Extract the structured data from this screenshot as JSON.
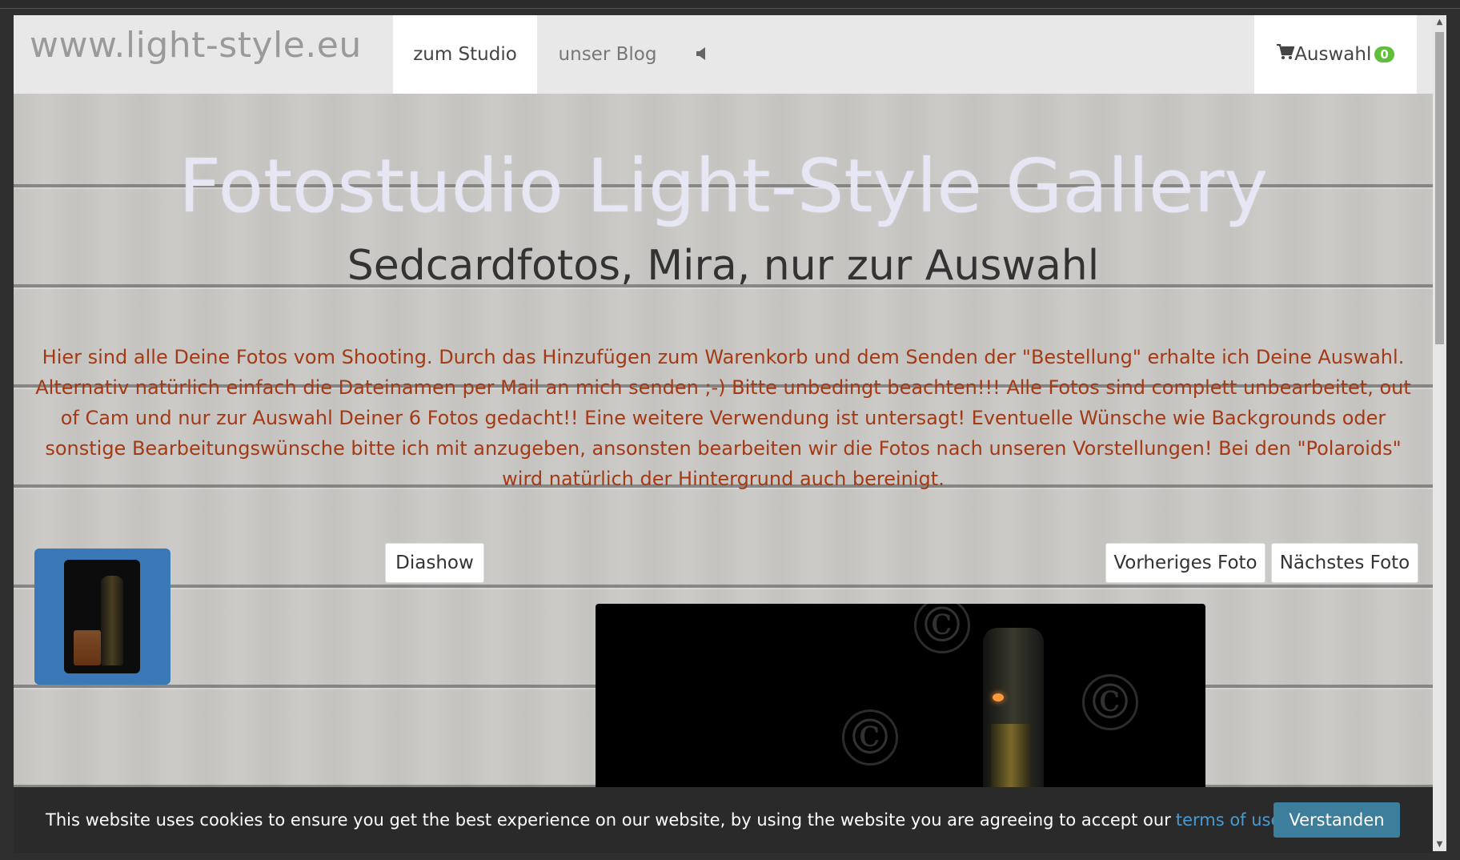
{
  "navbar": {
    "logo": "www.light-style.eu",
    "items": [
      {
        "label": "zum Studio"
      },
      {
        "label": "unser Blog"
      }
    ],
    "speaker_glyph": "◀",
    "cart": {
      "label": "Auswahl",
      "count": "0",
      "icon": "cart-icon"
    }
  },
  "header": {
    "title": "Fotostudio Light-Style Gallery",
    "subtitle": "Sedcardfotos, Mira, nur zur Auswahl"
  },
  "description": "Hier sind alle Deine Fotos vom Shooting. Durch das Hinzufügen zum Warenkorb und dem Senden der \"Bestellung\" erhalte ich Deine Auswahl. Alternativ natürlich einfach die Dateinamen per Mail an mich senden ;-) Bitte unbedingt beachten!!! Alle Fotos sind complett unbearbeitet, out of Cam und nur zur Auswahl Deiner 6 Fotos gedacht!! Eine weitere Verwendung ist untersagt! Eventuelle Wünsche wie Backgrounds oder sonstige Bearbeitungswünsche bitte ich mit anzugeben, ansonsten bearbeiten wir die Fotos nach unseren Vorstellungen! Bei den \"Polaroids\" wird natürlich der Hintergrund auch bereinigt.",
  "gallery": {
    "diashow_label": "Diashow",
    "prev_label": "Vorheriges Foto",
    "next_label": "Nächstes Foto",
    "watermark": "©"
  },
  "cookie": {
    "text": "This website uses cookies to ensure you get the best experience on our website, by using the website you are agreeing to accept our",
    "link": "terms of use",
    "period": ".",
    "button": "Verstanden"
  },
  "colors": {
    "accent_blue": "#3b78b8",
    "description_text": "#a33a15",
    "badge_green": "#5fbf3a",
    "cookie_button": "#3c7e9b",
    "link": "#4a9bd0"
  }
}
